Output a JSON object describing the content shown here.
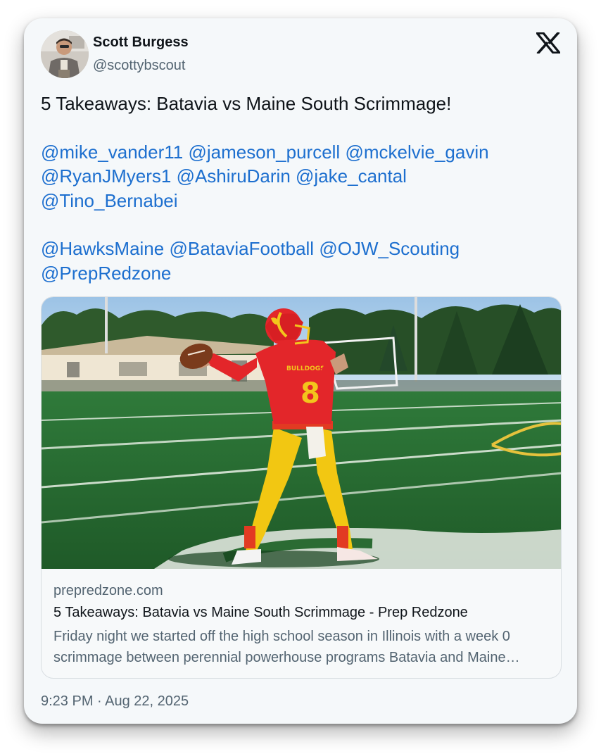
{
  "author": {
    "display_name": "Scott Burgess",
    "handle": "@scottybscout",
    "avatar_icon": "profile-photo"
  },
  "brand_icon": "x-logo-icon",
  "tweet": {
    "headline": "5 Takeaways: Batavia vs Maine South Scrimmage!",
    "mention_lines_1": [
      [
        "@mike_vander11",
        "@jameson_purcell",
        "@mckelvie_gavin"
      ],
      [
        "@RyanJMyers1",
        "@AshiruDarin",
        "@jake_cantal"
      ],
      [
        "@Tino_Bernabei"
      ]
    ],
    "mention_lines_2": [
      [
        "@HawksMaine",
        "@BataviaFootball",
        "@OJW_Scouting"
      ],
      [
        "@PrepRedzone"
      ]
    ]
  },
  "link_card": {
    "image": {
      "description_icon": "football-quarterback-photo",
      "jersey_number": "8",
      "jersey_text": "BULLDOGS"
    },
    "domain": "prepredzone.com",
    "title": "5 Takeaways: Batavia vs Maine South Scrimmage - Prep Redzone",
    "description": "Friday night we started off the high school season in Illinois with a week 0 scrimmage between perennial powerhouse programs Batavia and Maine South."
  },
  "timestamp": "9:23 PM · Aug 22, 2025",
  "colors": {
    "card_background": "#f5f8fa",
    "mention_blue": "#1d6fcf",
    "text_primary": "#0f1419",
    "text_secondary": "#536471"
  }
}
